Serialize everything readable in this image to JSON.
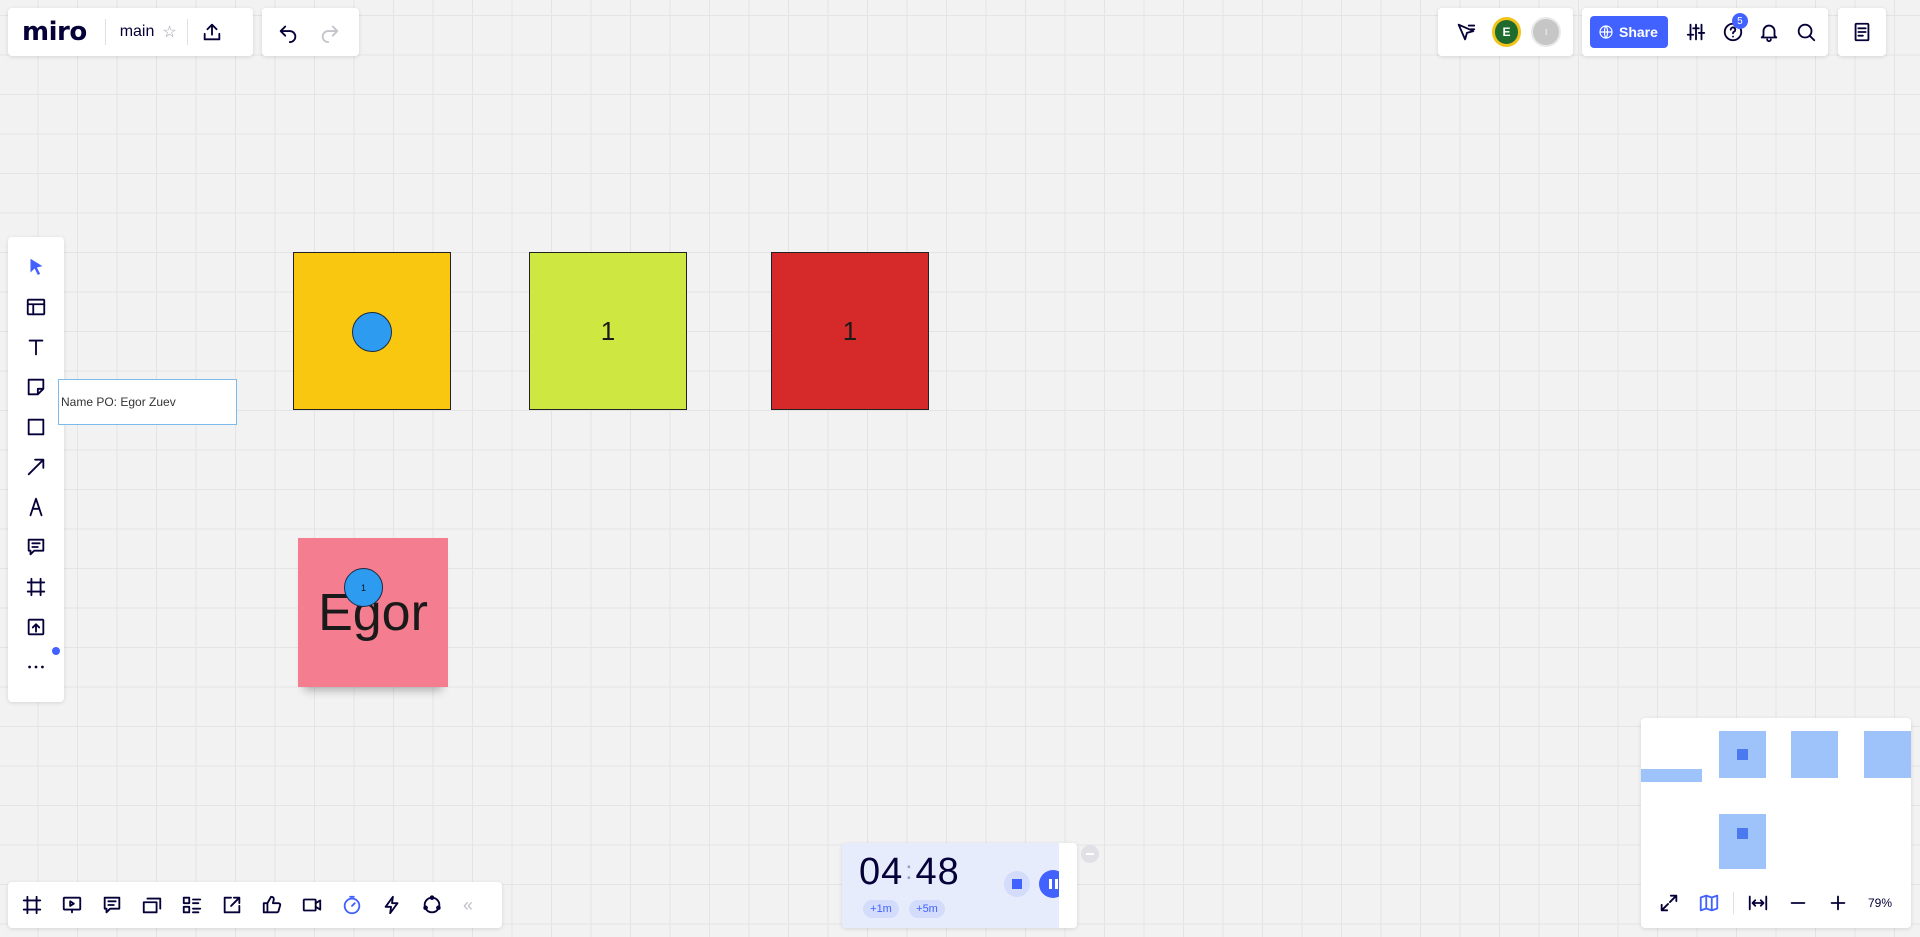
{
  "app": {
    "logo": "miro",
    "board_name": "main"
  },
  "header": {
    "share_label": "Share",
    "help_badge": "5",
    "collaborators": [
      {
        "initial": "E",
        "color": "#1e6b2d",
        "ring": "#f2c41b"
      },
      {
        "initial": "l",
        "color": "#c6c6c6"
      }
    ]
  },
  "left_toolbar": [
    "select-icon",
    "templates-icon",
    "text-icon",
    "sticky-note-icon",
    "shape-icon",
    "arrow-line-icon",
    "pen-icon",
    "comment-icon",
    "frame-icon",
    "upload-icon",
    "more-icon"
  ],
  "canvas": {
    "shapes": [
      {
        "color": "#fac710",
        "text": ""
      },
      {
        "color": "#cee741",
        "text": "1"
      },
      {
        "color": "#d62a2a",
        "text": "1"
      }
    ],
    "sticky_note": {
      "text": "Egor",
      "color": "#f47d8f",
      "dot_text": "1"
    },
    "text_label": "Name PO: Egor Zuev"
  },
  "bottom_toolbar": [
    "frames-icon",
    "presentation-icon",
    "comments-icon",
    "cards-icon",
    "list-icon",
    "external-icon",
    "voting-icon",
    "video-icon",
    "timer-icon",
    "lightning-icon",
    "loop-icon",
    "collapse-icon"
  ],
  "timer": {
    "minutes": "04",
    "separator": ":",
    "seconds": "48",
    "add_1m": "+1m",
    "add_5m": "+5m"
  },
  "minimap": {
    "zoom": "79%"
  },
  "colors": {
    "accent": "#4262ff"
  }
}
